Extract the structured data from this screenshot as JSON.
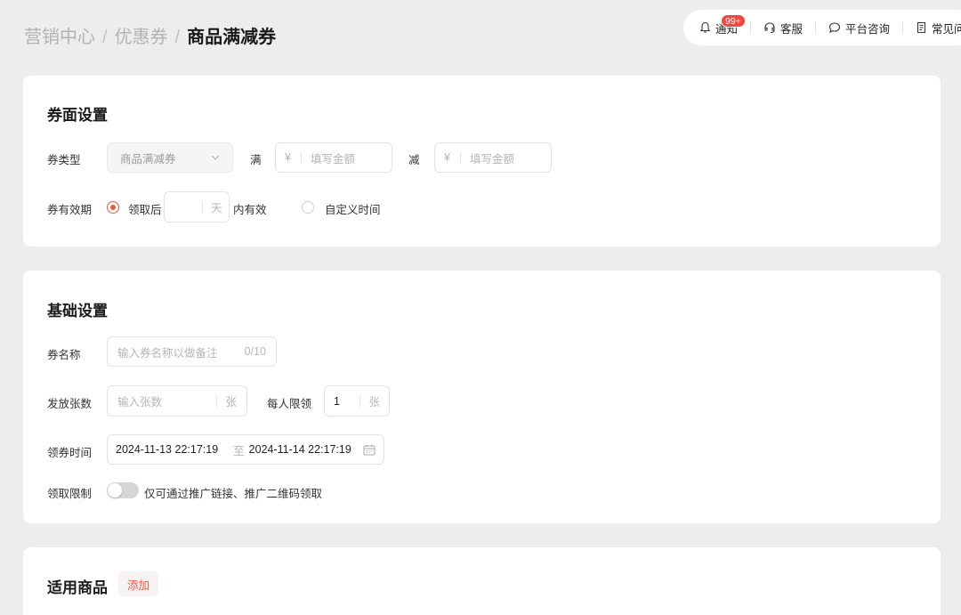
{
  "breadcrumb": {
    "items": [
      "营销中心",
      "优惠券"
    ],
    "current": "商品满减券",
    "separator": "/"
  },
  "topbar": {
    "notify_label": "通知",
    "notify_badge": "99+",
    "service_label": "客服",
    "consult_label": "平台咨询",
    "faq_label": "常见问题"
  },
  "coupon_face": {
    "title": "券面设置",
    "type_label": "券类型",
    "type_value": "商品满减券",
    "full_label": "满",
    "reduce_label": "减",
    "currency": "¥",
    "amount_placeholder": "填写金额",
    "validity_label": "券有效期",
    "option_after_claim": "领取后",
    "day_unit": "天",
    "within_valid": "内有效",
    "option_custom": "自定义时间",
    "selected_option": "领取后"
  },
  "basic": {
    "title": "基础设置",
    "name_label": "券名称",
    "name_placeholder": "输入券名称以做备注",
    "name_counter": "0/10",
    "count_label": "发放张数",
    "count_placeholder": "输入张数",
    "count_unit": "张",
    "limit_label": "每人限领",
    "limit_value": "1",
    "limit_unit": "张",
    "time_label": "领券时间",
    "time_start": "2024-11-13 22:17:19",
    "time_to": "至",
    "time_end": "2024-11-14 22:17:19",
    "restrict_label": "领取限制",
    "restrict_text": "仅可通过推广链接、推广二维码领取",
    "restrict_on": false
  },
  "products": {
    "title": "适用商品",
    "add_label": "添加"
  },
  "colors": {
    "accent": "#f0563f",
    "badge": "#f0473f",
    "background": "#ededed"
  }
}
